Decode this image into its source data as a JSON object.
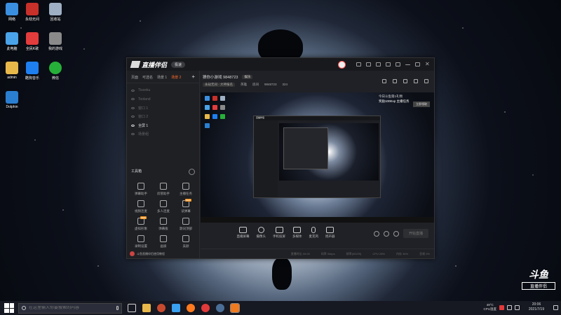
{
  "desktop": {
    "icons": [
      {
        "label": "网络",
        "color": "#3b8fe0"
      },
      {
        "label": "永劫无间",
        "color": "#c8302a"
      },
      {
        "label": "回收站",
        "color": "#9fb0c4"
      },
      {
        "label": "此电脑",
        "color": "#4aa3e8"
      },
      {
        "label": "微信",
        "color": "#26b03a"
      },
      {
        "label": "Dolphin",
        "color": "#2a7fd0"
      },
      {
        "label": "全民K歌",
        "color": "#e33c3c"
      },
      {
        "label": "我的游戏",
        "color": "#8a8a8a"
      },
      {
        "label": "admin",
        "color": "#e8b84a"
      },
      {
        "label": "酷狗音乐",
        "color": "#1e7ff0"
      }
    ]
  },
  "app": {
    "title": "直播伴侣",
    "version_label": "极速",
    "scene_tabs": [
      {
        "label": "页面"
      },
      {
        "label": "可选名"
      },
      {
        "label": "场景 1"
      },
      {
        "label": "场景 2",
        "active": true
      }
    ],
    "sources": [
      {
        "label": "Tiuveku",
        "visible": false
      },
      {
        "label": "Tooland",
        "visible": false
      },
      {
        "label": "窗口 1",
        "visible": false
      },
      {
        "label": "窗口 2",
        "visible": false
      },
      {
        "label": "全屏 1",
        "visible": true
      },
      {
        "label": "场景组",
        "visible": false
      }
    ],
    "tools_title": "工具箱",
    "tools": [
      {
        "label": "弹幕助手",
        "new": false
      },
      {
        "label": "房管助手",
        "new": false
      },
      {
        "label": "主播任务",
        "new": false
      },
      {
        "label": "视频连麦",
        "new": false
      },
      {
        "label": "多人连麦",
        "new": false
      },
      {
        "label": "读弹幕",
        "new": true
      },
      {
        "label": "虚拟形象",
        "new": true
      },
      {
        "label": "弹幕板",
        "new": false
      },
      {
        "label": "歌词顶部",
        "new": false
      },
      {
        "label": "录制设置",
        "new": false
      },
      {
        "label": "画质",
        "new": false
      },
      {
        "label": "美颜",
        "new": false
      }
    ],
    "tip_text": "斗鱼直播伴侣使用教程",
    "room": {
      "name": "猜你小游戏 9848723",
      "tag": "娱乐",
      "game_tag": "永劫无间 · 大神报名",
      "category": "英雄",
      "room_label": "房间",
      "room_id": "9848723",
      "hot_label": "324"
    },
    "preview": {
      "overlay_line1": "今日斗鱼第1礼物",
      "overlay_line2": "奖励100Exp 主播任务",
      "overlay_button": "立即领取",
      "nested_title": "直播伴侣"
    },
    "controls": [
      {
        "label": "直播屏幕"
      },
      {
        "label": "摄像头"
      },
      {
        "label": "手机投屏"
      },
      {
        "label": "多媒体"
      },
      {
        "label": "麦克风"
      },
      {
        "label": "扬声器"
      }
    ],
    "go_live": "开始直播",
    "status": [
      "直播时长 00:00",
      "码率 0kbps",
      "帧率(0/0/29)",
      "CPU 28%",
      "内存 34%",
      "丢帧 0%"
    ]
  },
  "watermark": {
    "big": "斗鱼",
    "small": "直播伴侣"
  },
  "taskbar": {
    "search_placeholder": "在这里输入你要搜索的内容",
    "apps": [
      {
        "name": "task-view",
        "color": "#d6d6d6"
      },
      {
        "name": "file-explorer",
        "color": "#e8b84a"
      },
      {
        "name": "game",
        "color": "#c84a2e"
      },
      {
        "name": "store",
        "color": "#3aa0f0"
      },
      {
        "name": "firefox",
        "color": "#ff7a1e"
      },
      {
        "name": "netease",
        "color": "#e13a3a"
      },
      {
        "name": "steam",
        "color": "#4a6e96"
      },
      {
        "name": "livehelper",
        "color": "#f07a1e"
      }
    ],
    "temp": "49°C",
    "temp_label": "CPU温度",
    "time": "20:06",
    "date": "2021/7/19"
  }
}
